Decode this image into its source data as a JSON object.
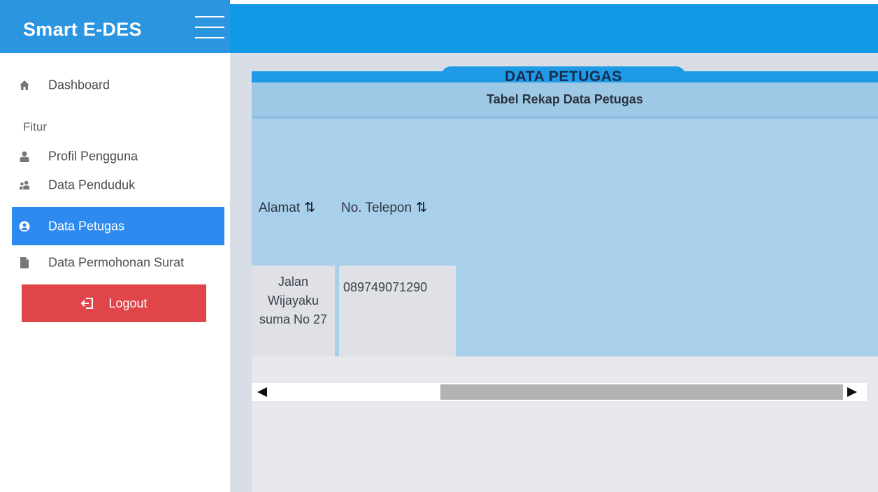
{
  "app": {
    "title": "Smart E-DES"
  },
  "colors": {
    "brand": "#2b95e0",
    "topbar": "#1199e6",
    "active": "#2f8af0",
    "logout": "#e0454a"
  },
  "sidebar": {
    "items": [
      {
        "label": "Dashboard",
        "icon": "home-icon"
      },
      {
        "label": "Profil Pengguna",
        "icon": "user-icon"
      },
      {
        "label": "Data  Penduduk",
        "icon": "users-icon"
      },
      {
        "label": "Data  Petugas",
        "icon": "user-circle-icon",
        "active": true
      },
      {
        "label": "Data Permohonan Surat",
        "icon": "file-icon"
      }
    ],
    "section": "Fitur",
    "logout_label": "Logout"
  },
  "main": {
    "panel_title": "DATA PETUGAS",
    "subtitle": "Tabel Rekap Data Petugas",
    "columns": [
      {
        "label": "Alamat",
        "sort": "⇅"
      },
      {
        "label": "No. Telepon",
        "sort": "⇅"
      }
    ],
    "rows": [
      {
        "alamat": "Jalan Wijayaku suma No 27",
        "telepon": "089749071290"
      }
    ]
  }
}
